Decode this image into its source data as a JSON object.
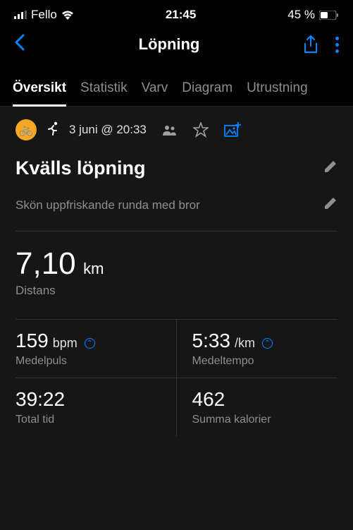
{
  "status": {
    "carrier": "Fello",
    "time": "21:45",
    "battery": "45 %"
  },
  "header": {
    "title": "Löpning"
  },
  "tabs": [
    {
      "label": "Översikt",
      "active": true
    },
    {
      "label": "Statistik",
      "active": false
    },
    {
      "label": "Varv",
      "active": false
    },
    {
      "label": "Diagram",
      "active": false
    },
    {
      "label": "Utrustning",
      "active": false
    }
  ],
  "activity": {
    "date": "3 juni @ 20:33",
    "title": "Kvälls löpning",
    "description": "Skön uppfriskande runda med bror",
    "distance": {
      "value": "7,10",
      "unit": "km",
      "label": "Distans"
    },
    "stats": [
      {
        "value": "159",
        "unit": "bpm",
        "label": "Medelpuls",
        "info": true
      },
      {
        "value": "5:33",
        "unit": "/km",
        "label": "Medeltempo",
        "info": true
      },
      {
        "value": "39:22",
        "unit": "",
        "label": "Total tid",
        "info": false
      },
      {
        "value": "462",
        "unit": "",
        "label": "Summa kalorier",
        "info": false
      }
    ]
  }
}
